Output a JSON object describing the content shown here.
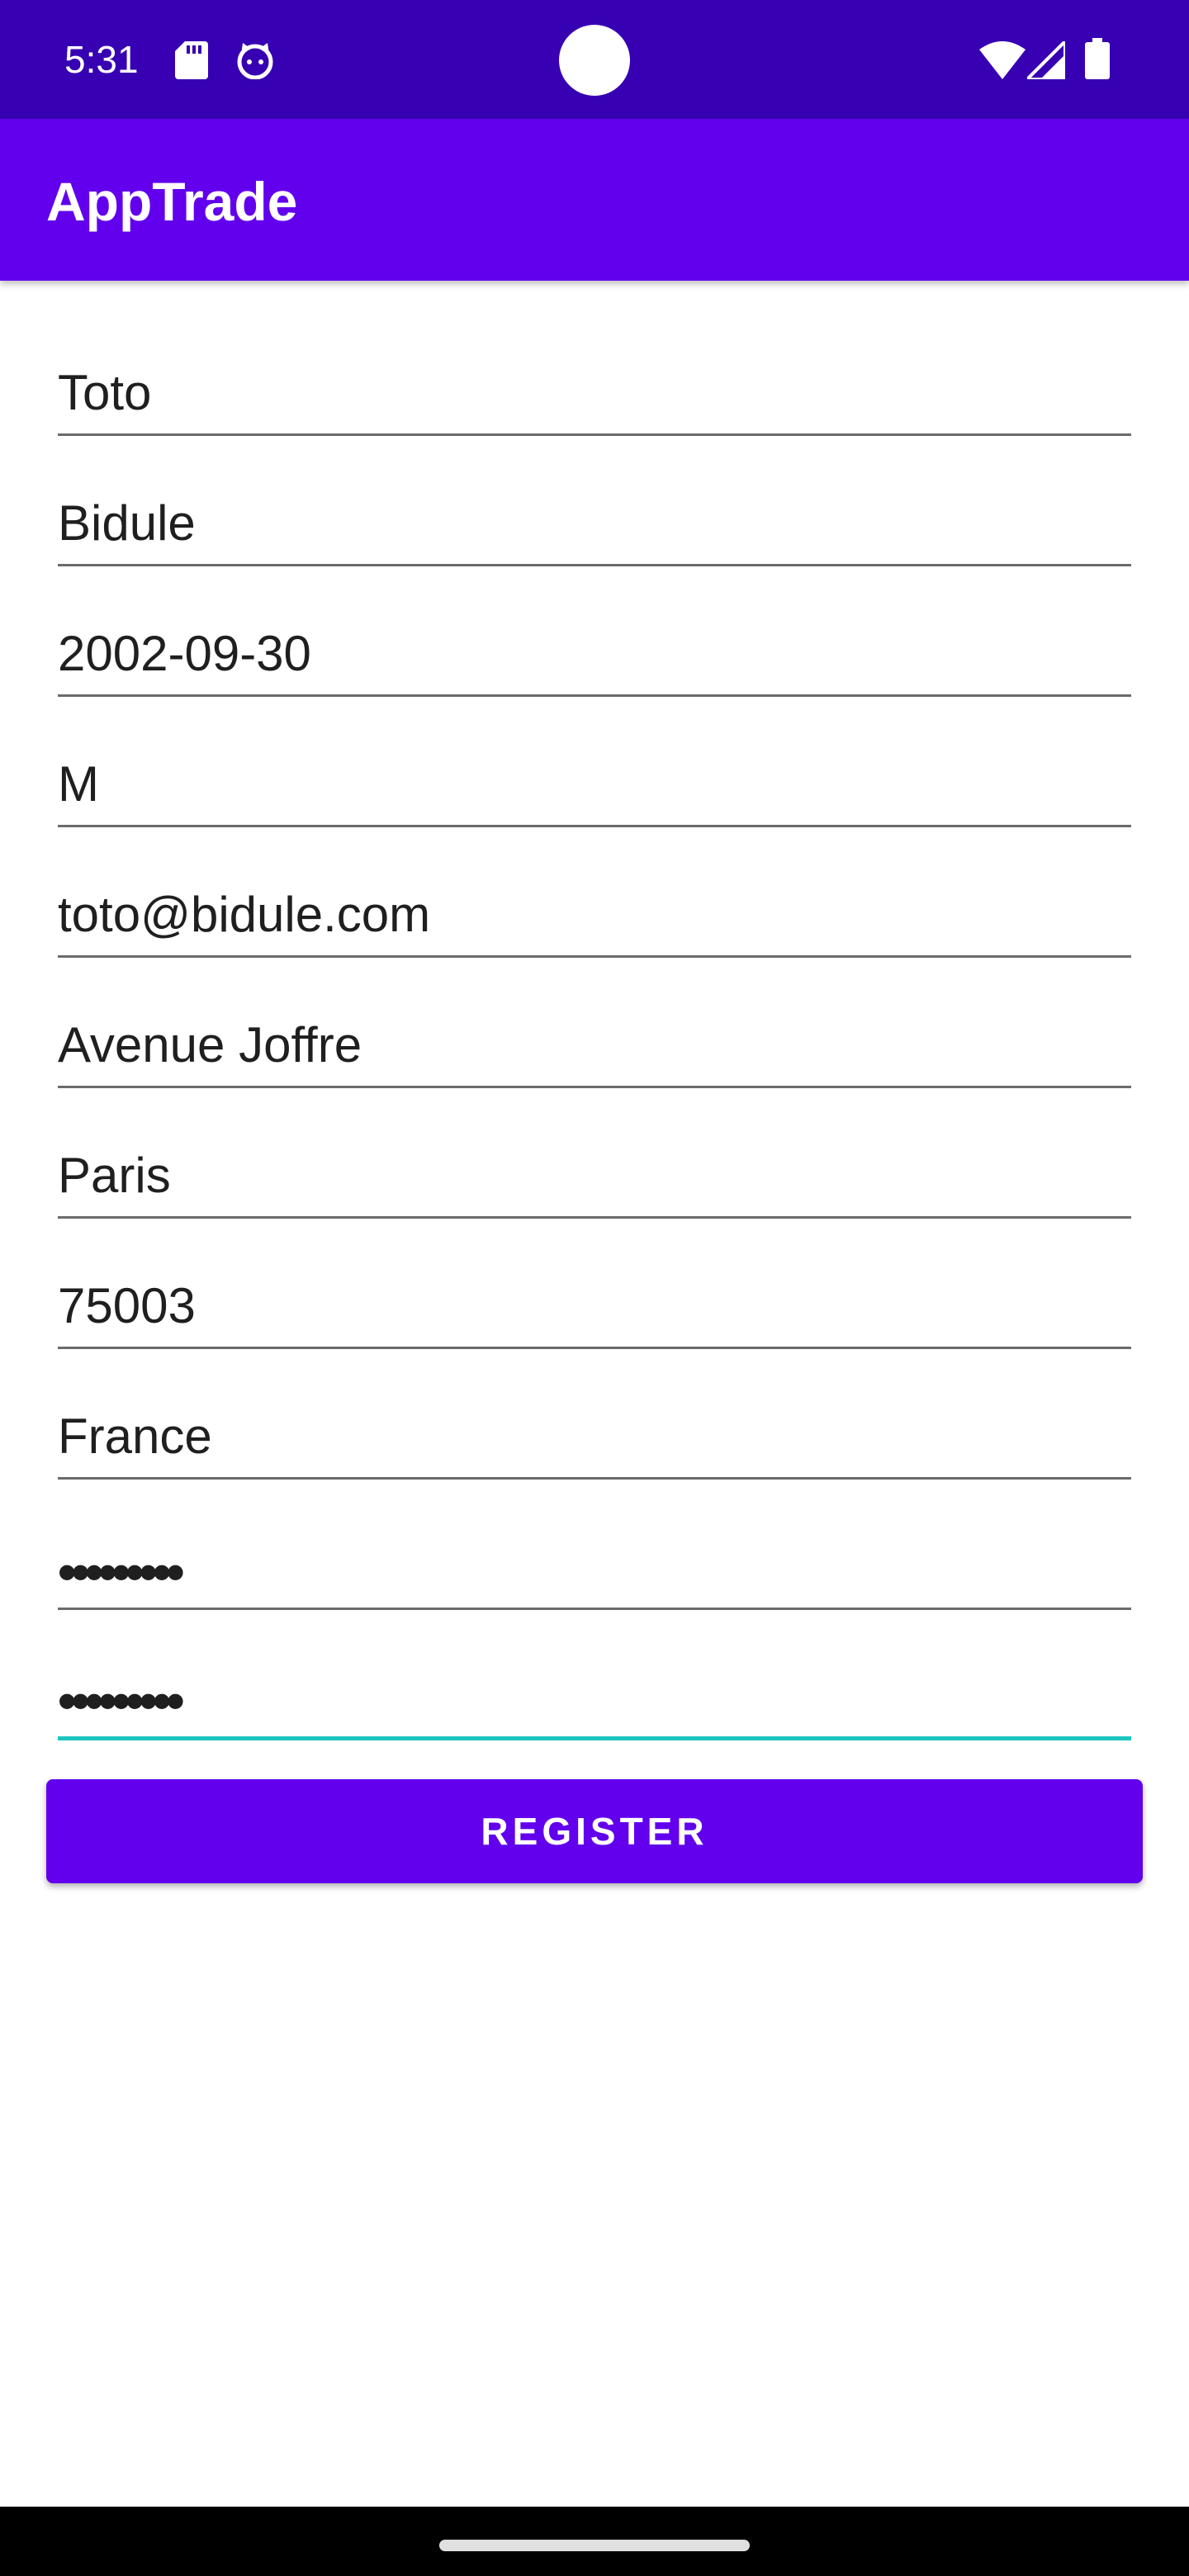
{
  "status_bar": {
    "time": "5:31",
    "icons": [
      "sd-card-icon",
      "cat-notification-icon",
      "wifi-icon",
      "signal-icon",
      "battery-icon"
    ],
    "color": "#3700B3"
  },
  "app_bar": {
    "title": "AppTrade",
    "color": "#6200EE"
  },
  "form": {
    "fields": [
      {
        "name": "first-name-field",
        "value": "Toto"
      },
      {
        "name": "last-name-field",
        "value": "Bidule"
      },
      {
        "name": "birthdate-field",
        "value": "2002-09-30"
      },
      {
        "name": "gender-field",
        "value": "M"
      },
      {
        "name": "email-field",
        "value": "toto@bidule.com"
      },
      {
        "name": "street-field",
        "value": "Avenue Joffre"
      },
      {
        "name": "city-field",
        "value": "Paris"
      },
      {
        "name": "postal-code-field",
        "value": "75003"
      },
      {
        "name": "country-field",
        "value": "France"
      },
      {
        "name": "password-field",
        "value": "•••••••••"
      },
      {
        "name": "confirm-password-field",
        "value": "•••••••••"
      }
    ],
    "focused_field_color": "#1DC5BE",
    "register_label": "REGISTER"
  }
}
